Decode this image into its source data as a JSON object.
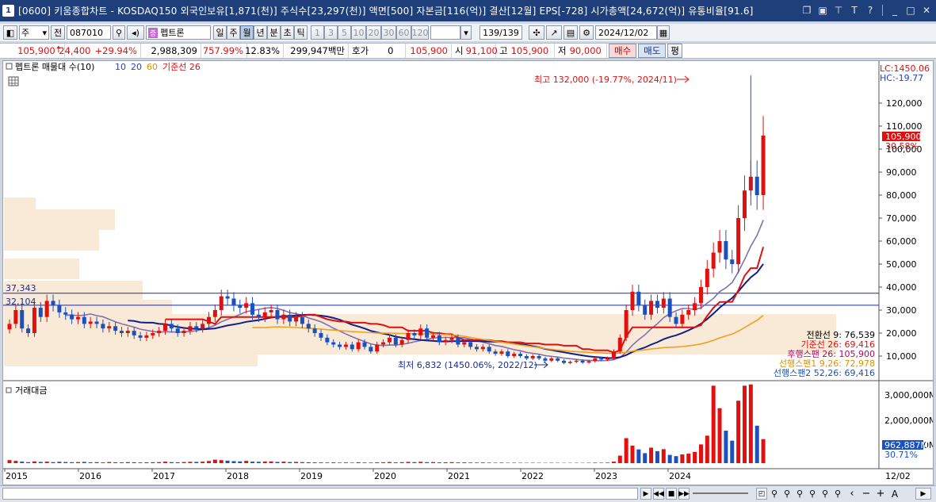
{
  "window": {
    "app_number": "1",
    "title": "[0600] 키움종합차트 - KOSDAQ150 외국인보유[1,871(천)] 주식수[23,297(천)] 액면[500] 자본금[116(억)] 결산[12월] EPS[-728] 시가총액[24,672(억)] 유통비율[91.6]",
    "icons": [
      "restore-icon",
      "layout-icon",
      "pin-icon",
      "text-icon",
      "help-icon",
      "minimize-icon",
      "maximize-icon",
      "close-icon"
    ]
  },
  "toolbar": {
    "market_select": "주",
    "market_arrow": "▾",
    "prev_label": "전",
    "code": "087010",
    "stock_badge": "증",
    "stock_name": "펩트론",
    "periods": [
      "일",
      "주",
      "월",
      "년",
      "분",
      "초",
      "틱"
    ],
    "active_period": "월",
    "intervals": [
      "1",
      "3",
      "5",
      "10",
      "20",
      "30",
      "60",
      "120"
    ],
    "count": "139/139",
    "date": "2024/12/02"
  },
  "pricebar": {
    "price": "105,900",
    "change": "24,400",
    "change_pct": "+29.94%",
    "volume": "2,988,309",
    "vol_ratio": "757.99%",
    "turnover": "12.83%",
    "amount": "299,947백만",
    "quote_label": "호가",
    "quote_value": "0",
    "price2": "105,900",
    "open_label": "시",
    "open": "91,100",
    "high_label": "고",
    "high": "105,900",
    "low_label": "저",
    "low": "90,000",
    "buy": "매수",
    "sell": "매도",
    "eval": "평"
  },
  "chart": {
    "legend_title": "펩트론 매물대 수(10)",
    "ma_labels": [
      "10",
      "20",
      "60"
    ],
    "ma_colors": [
      "#2040c0",
      "#2040c0",
      "#e09000"
    ],
    "base_label": "기준선 26",
    "lc_label": "LC:1450.06",
    "hc_label": "HC:-19.77",
    "y_ticks": [
      "120,000",
      "110,000",
      "100,000",
      "90,000",
      "80,000",
      "70,000",
      "60,000",
      "50,000",
      "40,000",
      "30,000",
      "20,000",
      "10,000"
    ],
    "current_price": "105,900",
    "current_pct": "30.58%",
    "hline1": "37,343",
    "hline2": "32,104",
    "max_note": "최고 132,000 (-19.77%, 2024/11)",
    "min_note": "최저 6,832 (1450.06%, 2022/12)",
    "ichimoku": [
      {
        "label": "전환선 9: 76,539",
        "color": "#000000"
      },
      {
        "label": "기준선 26: 69,416",
        "color": "#e01010"
      },
      {
        "label": "후행스팬 26: 105,900",
        "color": "#a01060"
      },
      {
        "label": "선행스팬1 9,26: 72,978",
        "color": "#e09000"
      },
      {
        "label": "선행스팬2 52,26: 69,416",
        "color": "#2050b0"
      }
    ],
    "volume_title": "거래대금",
    "volume_ticks": [
      "3,000,000M",
      "2,000,000M",
      "1,000,000M"
    ],
    "volume_current": "962,887M",
    "volume_pct": "30.71%",
    "x_labels": [
      "2015",
      "2016",
      "2017",
      "2018",
      "2019",
      "2020",
      "2021",
      "2022",
      "2023",
      "2024"
    ],
    "x_end": "12/02"
  }
}
